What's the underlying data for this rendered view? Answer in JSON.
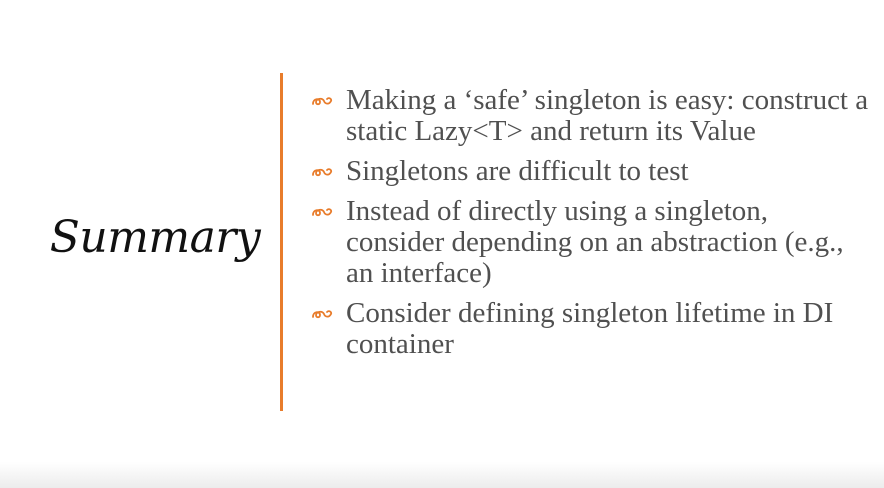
{
  "slide": {
    "title": "Summary",
    "accent_color": "#e87c2b",
    "bullet_icon": "orange-curl-ornament-icon",
    "bullets": [
      "Making a ‘safe’ singleton is easy: construct a static Lazy<T> and return its Value",
      "Singletons are difficult to test",
      "Instead of directly using a singleton, consider depending on an abstraction (e.g., an interface)",
      "Consider defining singleton lifetime in DI container"
    ]
  }
}
